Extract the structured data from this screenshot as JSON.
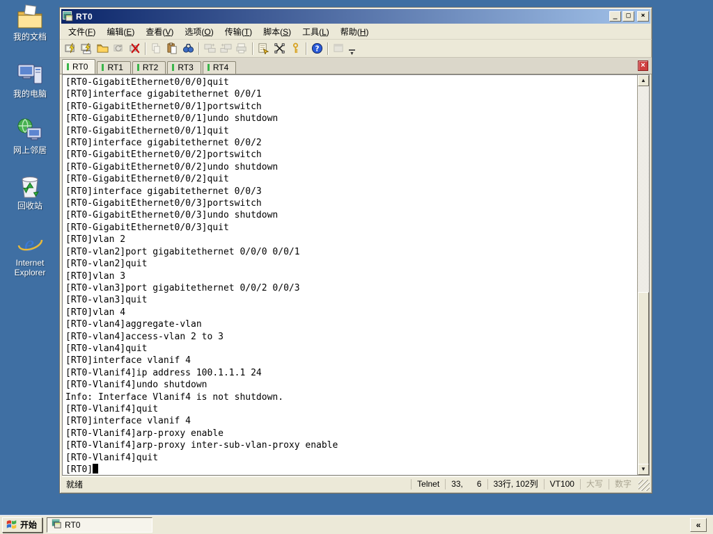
{
  "colors": {
    "desktop": "#3F6FA3",
    "chrome": "#ECE9D8",
    "titlebar_start": "#0B2569",
    "titlebar_end": "#A3C3EA",
    "terminal_bg": "#FFFFFF",
    "terminal_fg": "#000000",
    "tab_led": "#39B54A",
    "tab_close": "#CF4040"
  },
  "desktop": {
    "icons": [
      {
        "name": "my-documents",
        "label": "我的文档"
      },
      {
        "name": "my-computer",
        "label": "我的电脑"
      },
      {
        "name": "network-places",
        "label": "网上邻居"
      },
      {
        "name": "recycle-bin",
        "label": "回收站"
      },
      {
        "name": "internet-explorer",
        "label": "Internet Explorer"
      }
    ]
  },
  "window": {
    "title": "RT0",
    "controls": {
      "minimize": "_",
      "maximize": "□",
      "close": "×"
    },
    "menu": {
      "items": [
        {
          "name": "menu-file",
          "label": "文件(F)"
        },
        {
          "name": "menu-edit",
          "label": "编辑(E)"
        },
        {
          "name": "menu-view",
          "label": "查看(V)"
        },
        {
          "name": "menu-options",
          "label": "选项(O)"
        },
        {
          "name": "menu-transfer",
          "label": "传输(T)"
        },
        {
          "name": "menu-script",
          "label": "脚本(S)"
        },
        {
          "name": "menu-tools",
          "label": "工具(L)"
        },
        {
          "name": "menu-help",
          "label": "帮助(H)"
        }
      ]
    },
    "toolbar": {
      "items": [
        {
          "name": "quick-connect-icon",
          "type": "term-bolt",
          "enabled": true
        },
        {
          "name": "connect-in-tab-icon",
          "type": "term-bolt-tab",
          "enabled": true
        },
        {
          "name": "connect-icon",
          "type": "folder",
          "enabled": true
        },
        {
          "name": "reconnect-icon",
          "type": "term-reload",
          "enabled": false
        },
        {
          "name": "disconnect-icon",
          "type": "term-x",
          "enabled": true
        },
        {
          "sep": true
        },
        {
          "name": "copy-icon",
          "type": "copy",
          "enabled": false
        },
        {
          "name": "paste-icon",
          "type": "paste",
          "enabled": true
        },
        {
          "name": "find-icon",
          "type": "binoculars",
          "enabled": true
        },
        {
          "sep": true
        },
        {
          "name": "transfer-send-icon",
          "type": "transfer",
          "enabled": false
        },
        {
          "name": "transfer-receive-icon",
          "type": "transfer2",
          "enabled": false
        },
        {
          "name": "print-icon",
          "type": "printer",
          "enabled": false
        },
        {
          "sep": true
        },
        {
          "name": "session-options-icon",
          "type": "options",
          "enabled": true
        },
        {
          "name": "keymap-icon",
          "type": "keymap",
          "enabled": true
        },
        {
          "name": "key-icon",
          "type": "key",
          "enabled": true
        },
        {
          "sep": true
        },
        {
          "name": "help-icon",
          "type": "help",
          "enabled": true
        },
        {
          "sep": true
        },
        {
          "name": "app-window-icon",
          "type": "window",
          "enabled": false
        }
      ]
    },
    "tabs": [
      {
        "name": "tab-rt0",
        "label": "RT0",
        "active": true
      },
      {
        "name": "tab-rt1",
        "label": "RT1",
        "active": false
      },
      {
        "name": "tab-rt2",
        "label": "RT2",
        "active": false
      },
      {
        "name": "tab-rt3",
        "label": "RT3",
        "active": false
      },
      {
        "name": "tab-rt4",
        "label": "RT4",
        "active": false
      }
    ],
    "terminal": {
      "cursor_visible": true,
      "lines": [
        "[RT0-GigabitEthernet0/0/0]quit",
        "[RT0]interface gigabitethernet 0/0/1",
        "[RT0-GigabitEthernet0/0/1]portswitch",
        "[RT0-GigabitEthernet0/0/1]undo shutdown",
        "[RT0-GigabitEthernet0/0/1]quit",
        "[RT0]interface gigabitethernet 0/0/2",
        "[RT0-GigabitEthernet0/0/2]portswitch",
        "[RT0-GigabitEthernet0/0/2]undo shutdown",
        "[RT0-GigabitEthernet0/0/2]quit",
        "[RT0]interface gigabitethernet 0/0/3",
        "[RT0-GigabitEthernet0/0/3]portswitch",
        "[RT0-GigabitEthernet0/0/3]undo shutdown",
        "[RT0-GigabitEthernet0/0/3]quit",
        "[RT0]vlan 2",
        "[RT0-vlan2]port gigabitethernet 0/0/0 0/0/1",
        "[RT0-vlan2]quit",
        "[RT0]vlan 3",
        "[RT0-vlan3]port gigabitethernet 0/0/2 0/0/3",
        "[RT0-vlan3]quit",
        "[RT0]vlan 4",
        "[RT0-vlan4]aggregate-vlan",
        "[RT0-vlan4]access-vlan 2 to 3",
        "[RT0-vlan4]quit",
        "[RT0]interface vlanif 4",
        "[RT0-Vlanif4]ip address 100.1.1.1 24",
        "[RT0-Vlanif4]undo shutdown",
        "Info: Interface Vlanif4 is not shutdown.",
        "[RT0-Vlanif4]quit",
        "[RT0]interface vlanif 4",
        "[RT0-Vlanif4]arp-proxy enable",
        "[RT0-Vlanif4]arp-proxy inter-sub-vlan-proxy enable",
        "[RT0-Vlanif4]quit",
        "[RT0]"
      ]
    },
    "statusbar": {
      "message": "就绪",
      "protocol": "Telnet",
      "cursor_pos": "33,      6",
      "grid": "33行, 102列",
      "emulation": "VT100",
      "caps_label": "大写",
      "num_label": "数字"
    }
  },
  "taskbar": {
    "start_label": "开始",
    "tasks": [
      {
        "label": "RT0",
        "active": true
      }
    ],
    "overflow": "«"
  }
}
